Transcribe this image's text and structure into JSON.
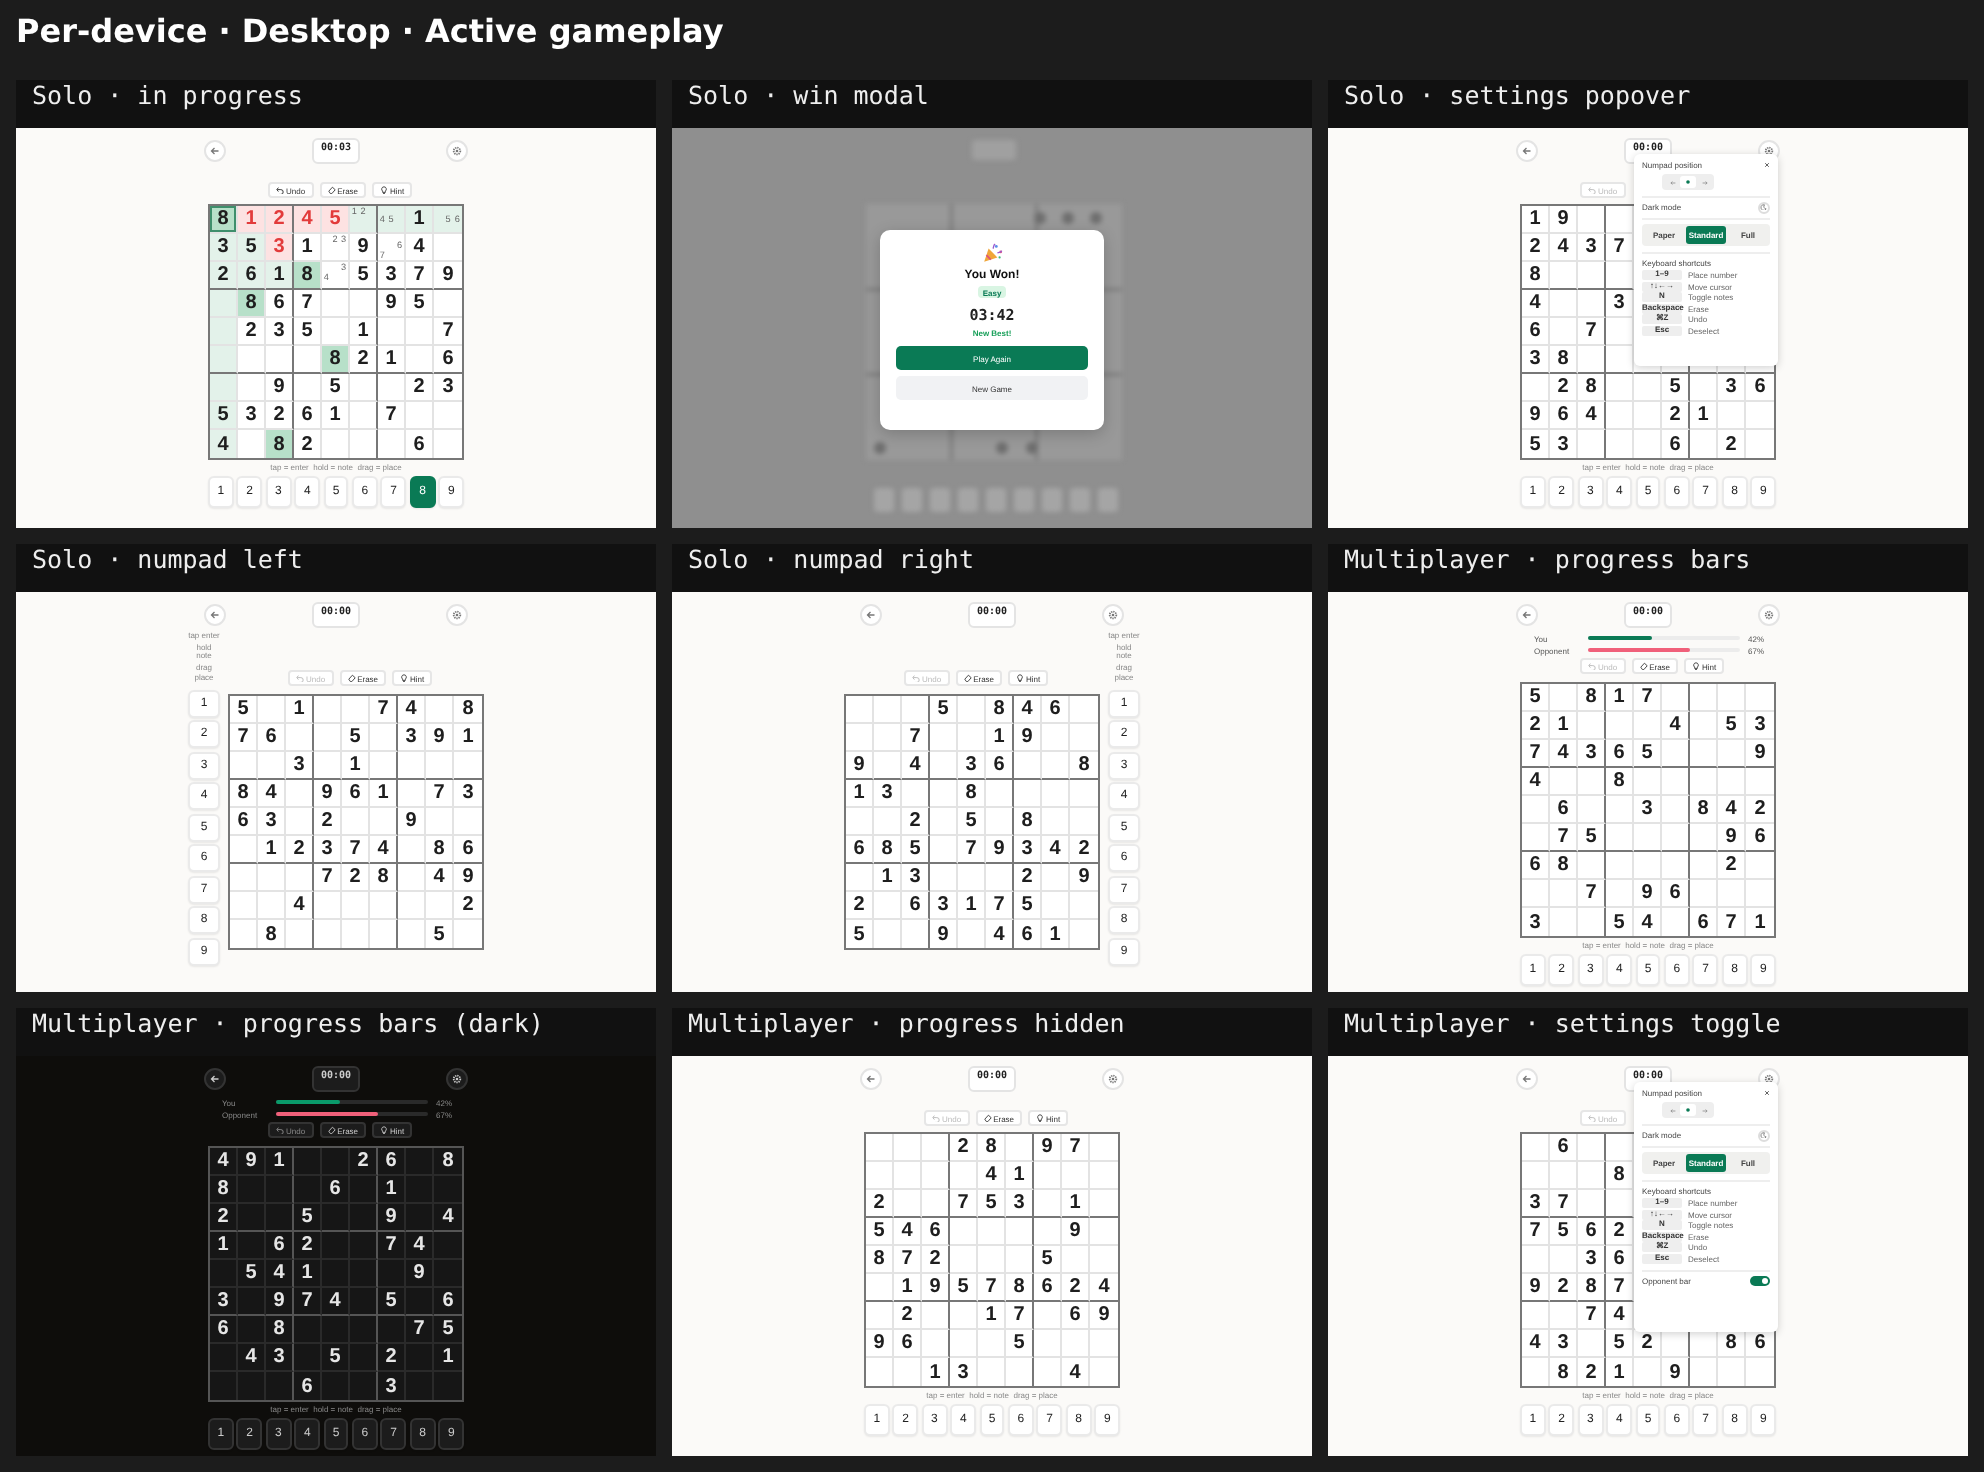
{
  "title": "Per-device · Desktop · Active gameplay",
  "panels": [
    {
      "label": "Solo · in progress",
      "kind": "bottom",
      "dark": false,
      "timer": "00:03",
      "toolbar": [
        {
          "kind": "undo",
          "label": "Undo",
          "disabled": false
        },
        {
          "kind": "erase",
          "label": "Erase",
          "disabled": false
        },
        {
          "kind": "hint",
          "label": "Hint",
          "disabled": false
        }
      ],
      "board": {
        "rows": [
          [
            {
              "value": "8",
              "selected": true
            },
            {
              "value": "1",
              "error": true
            },
            {
              "value": "2",
              "error": true
            },
            {
              "value": "4",
              "error": true
            },
            {
              "value": "5",
              "error": true
            },
            {
              "notes": [
                "1",
                "2"
              ]
            },
            {
              "notes": [
                "4",
                "5"
              ]
            },
            "1",
            {
              "notes": [
                "5",
                "6"
              ]
            }
          ],
          [
            "3",
            "5",
            {
              "value": "3",
              "error": true
            },
            "1",
            {
              "notes": [
                "2",
                "3"
              ]
            },
            "9",
            {
              "notes": [
                "6",
                "7"
              ]
            },
            "4",
            null
          ],
          [
            "2",
            "6",
            "1",
            "8",
            {
              "notes": [
                "3",
                "4"
              ]
            },
            "5",
            "3",
            "7",
            "9"
          ],
          [
            null,
            "8",
            "6",
            "7",
            null,
            null,
            "9",
            "5",
            null
          ],
          [
            null,
            "2",
            "3",
            "5",
            null,
            "1",
            null,
            null,
            "7"
          ],
          [
            null,
            null,
            null,
            null,
            "8",
            "2",
            "1",
            null,
            "6"
          ],
          [
            null,
            null,
            "9",
            null,
            "5",
            null,
            null,
            "2",
            "3"
          ],
          [
            "5",
            "3",
            "2",
            "6",
            "1",
            null,
            "7",
            null,
            null
          ],
          [
            "4",
            null,
            "8",
            "2",
            null,
            null,
            null,
            "6",
            null
          ]
        ]
      },
      "hint": "tap = enter  hold = note  drag = place",
      "numpad": [
        {
          "label": "1",
          "selected": false
        },
        {
          "label": "2",
          "selected": false
        },
        {
          "label": "3",
          "selected": false
        },
        {
          "label": "4",
          "selected": false
        },
        {
          "label": "5",
          "selected": false
        },
        {
          "label": "6",
          "selected": false
        },
        {
          "label": "7",
          "selected": false
        },
        {
          "label": "8",
          "selected": true
        },
        {
          "label": "9",
          "selected": false
        }
      ]
    },
    {
      "label": "Solo · win modal",
      "kind": "modal",
      "modal": {
        "title": "You Won!",
        "difficulty": "Easy",
        "time": "03:42",
        "note": "New Best!",
        "buttons": [
          {
            "kind": "primary",
            "label": "Play Again"
          },
          {
            "kind": "secondary",
            "label": "New Game"
          }
        ]
      }
    },
    {
      "label": "Solo · settings popover",
      "kind": "bottom",
      "dark": false,
      "timer": "00:00",
      "toolbar": [
        {
          "kind": "undo",
          "label": "Undo",
          "disabled": true
        }
      ],
      "board": {
        "rows": [
          [
            "1",
            "9",
            null,
            null,
            null,
            null,
            null,
            null,
            null
          ],
          [
            "2",
            "4",
            "3",
            "7",
            null,
            null,
            null,
            null,
            null
          ],
          [
            "8",
            null,
            null,
            null,
            null,
            null,
            null,
            null,
            null
          ],
          [
            "4",
            null,
            null,
            "3",
            null,
            null,
            null,
            null,
            null
          ],
          [
            "6",
            null,
            "7",
            null,
            null,
            null,
            null,
            null,
            null
          ],
          [
            "3",
            "8",
            null,
            null,
            null,
            null,
            null,
            null,
            null
          ],
          [
            null,
            "2",
            "8",
            null,
            null,
            "5",
            null,
            "3",
            "6"
          ],
          [
            "9",
            "6",
            "4",
            null,
            null,
            "2",
            "1",
            null,
            null
          ],
          [
            "5",
            "3",
            null,
            null,
            null,
            "6",
            null,
            "2",
            null
          ]
        ]
      },
      "hint": "tap = enter  hold = note  drag = place",
      "numpad": [
        {
          "label": "1",
          "selected": false
        },
        {
          "label": "2",
          "selected": false
        },
        {
          "label": "3",
          "selected": false
        },
        {
          "label": "4",
          "selected": false
        },
        {
          "label": "5",
          "selected": false
        },
        {
          "label": "6",
          "selected": false
        },
        {
          "label": "7",
          "selected": false
        },
        {
          "label": "8",
          "selected": false
        },
        {
          "label": "9",
          "selected": false
        }
      ],
      "popover": {
        "title": "Numpad position",
        "position_options": [
          {
            "kind": "left",
            "selected": false
          },
          {
            "kind": "center",
            "selected": true
          },
          {
            "kind": "right",
            "selected": false
          }
        ],
        "dark_mode_label": "Dark mode",
        "modes": [
          {
            "label": "Paper",
            "selected": false
          },
          {
            "label": "Standard",
            "selected": true
          },
          {
            "label": "Full",
            "selected": false
          }
        ],
        "shortcuts_title": "Keyboard shortcuts",
        "shortcuts": [
          {
            "key": "1–9",
            "action": "Place number"
          },
          {
            "key": "↑↓←→",
            "action": "Move cursor"
          },
          {
            "key": "N",
            "action": "Toggle notes"
          },
          {
            "key": "Backspace",
            "action": "Erase"
          },
          {
            "key": "⌘Z",
            "action": "Undo"
          },
          {
            "key": "Esc",
            "action": "Deselect"
          }
        ]
      }
    },
    {
      "label": "Solo · numpad left",
      "kind": "left",
      "dark": false,
      "timer": "00:00",
      "toolbar": [
        {
          "kind": "undo",
          "label": "Undo",
          "disabled": true
        },
        {
          "kind": "erase",
          "label": "Erase",
          "disabled": false
        },
        {
          "kind": "hint",
          "label": "Hint",
          "disabled": false
        }
      ],
      "board": {
        "rows": [
          [
            "5",
            null,
            "1",
            null,
            null,
            "7",
            "4",
            null,
            "8"
          ],
          [
            "7",
            "6",
            null,
            null,
            "5",
            null,
            "3",
            "9",
            "1"
          ],
          [
            null,
            null,
            "3",
            null,
            "1",
            null,
            null,
            null,
            null
          ],
          [
            "8",
            "4",
            null,
            "9",
            "6",
            "1",
            null,
            "7",
            "3"
          ],
          [
            "6",
            "3",
            null,
            "2",
            null,
            null,
            "9",
            null,
            null
          ],
          [
            null,
            "1",
            "2",
            "3",
            "7",
            "4",
            null,
            "8",
            "6"
          ],
          [
            null,
            null,
            null,
            "7",
            "2",
            "8",
            null,
            "4",
            "9"
          ],
          [
            null,
            null,
            "4",
            null,
            null,
            null,
            null,
            null,
            "2"
          ],
          [
            null,
            "8",
            null,
            null,
            null,
            null,
            null,
            "5",
            null
          ]
        ]
      },
      "hints": [
        "tap enter",
        "hold note",
        "drag place"
      ],
      "numpad": [
        {
          "label": "1",
          "selected": false
        },
        {
          "label": "2",
          "selected": false
        },
        {
          "label": "3",
          "selected": false
        },
        {
          "label": "4",
          "selected": false
        },
        {
          "label": "5",
          "selected": false
        },
        {
          "label": "6",
          "selected": false
        },
        {
          "label": "7",
          "selected": false
        },
        {
          "label": "8",
          "selected": false
        },
        {
          "label": "9",
          "selected": false
        }
      ]
    },
    {
      "label": "Solo · numpad right",
      "kind": "right",
      "dark": false,
      "timer": "00:00",
      "toolbar": [
        {
          "kind": "undo",
          "label": "Undo",
          "disabled": true
        },
        {
          "kind": "erase",
          "label": "Erase",
          "disabled": false
        },
        {
          "kind": "hint",
          "label": "Hint",
          "disabled": false
        }
      ],
      "board": {
        "rows": [
          [
            null,
            null,
            null,
            "5",
            null,
            "8",
            "4",
            "6",
            null
          ],
          [
            null,
            null,
            "7",
            null,
            null,
            "1",
            "9",
            null,
            null
          ],
          [
            "9",
            null,
            "4",
            null,
            "3",
            "6",
            null,
            null,
            "8"
          ],
          [
            "1",
            "3",
            null,
            null,
            "8",
            null,
            null,
            null,
            null
          ],
          [
            null,
            null,
            "2",
            null,
            "5",
            null,
            "8",
            null,
            null
          ],
          [
            "6",
            "8",
            "5",
            null,
            "7",
            "9",
            "3",
            "4",
            "2"
          ],
          [
            null,
            "1",
            "3",
            null,
            null,
            null,
            "2",
            null,
            "9"
          ],
          [
            "2",
            null,
            "6",
            "3",
            "1",
            "7",
            "5",
            null,
            null
          ],
          [
            "5",
            null,
            null,
            "9",
            null,
            "4",
            "6",
            "1",
            null
          ]
        ]
      },
      "hints": [
        "tap enter",
        "hold note",
        "drag place"
      ],
      "numpad": [
        {
          "label": "1",
          "selected": false
        },
        {
          "label": "2",
          "selected": false
        },
        {
          "label": "3",
          "selected": false
        },
        {
          "label": "4",
          "selected": false
        },
        {
          "label": "5",
          "selected": false
        },
        {
          "label": "6",
          "selected": false
        },
        {
          "label": "7",
          "selected": false
        },
        {
          "label": "8",
          "selected": false
        },
        {
          "label": "9",
          "selected": false
        }
      ]
    },
    {
      "label": "Multiplayer · progress bars",
      "kind": "bottom",
      "dark": false,
      "timer": "00:00",
      "progress": [
        {
          "name": "You",
          "level": 0.42,
          "reading": "42%",
          "color": "#0a7a55"
        },
        {
          "name": "Opponent",
          "level": 0.67,
          "reading": "67%",
          "color": "#f0607a"
        }
      ],
      "toolbar": [
        {
          "kind": "undo",
          "label": "Undo",
          "disabled": true
        },
        {
          "kind": "erase",
          "label": "Erase",
          "disabled": false
        },
        {
          "kind": "hint",
          "label": "Hint",
          "disabled": false
        }
      ],
      "board": {
        "rows": [
          [
            "5",
            null,
            "8",
            "1",
            "7",
            null,
            null,
            null,
            null
          ],
          [
            "2",
            "1",
            null,
            null,
            null,
            "4",
            null,
            "5",
            "3"
          ],
          [
            "7",
            "4",
            "3",
            "6",
            "5",
            null,
            null,
            null,
            "9"
          ],
          [
            "4",
            null,
            null,
            "8",
            null,
            null,
            null,
            null,
            null
          ],
          [
            null,
            "6",
            null,
            null,
            "3",
            null,
            "8",
            "4",
            "2"
          ],
          [
            null,
            "7",
            "5",
            null,
            null,
            null,
            null,
            "9",
            "6"
          ],
          [
            "6",
            "8",
            null,
            null,
            null,
            null,
            null,
            "2",
            null
          ],
          [
            null,
            null,
            "7",
            null,
            "9",
            "6",
            null,
            null,
            null
          ],
          [
            "3",
            null,
            null,
            "5",
            "4",
            null,
            "6",
            "7",
            "1"
          ]
        ]
      },
      "hint": "tap = enter  hold = note  drag = place",
      "numpad": [
        {
          "label": "1",
          "selected": false
        },
        {
          "label": "2",
          "selected": false
        },
        {
          "label": "3",
          "selected": false
        },
        {
          "label": "4",
          "selected": false
        },
        {
          "label": "5",
          "selected": false
        },
        {
          "label": "6",
          "selected": false
        },
        {
          "label": "7",
          "selected": false
        },
        {
          "label": "8",
          "selected": false
        },
        {
          "label": "9",
          "selected": false
        }
      ]
    },
    {
      "label": "Multiplayer · progress bars (dark)",
      "kind": "bottom",
      "dark": true,
      "timer": "00:00",
      "progress": [
        {
          "name": "You",
          "level": 0.42,
          "reading": "42%",
          "color": "#0a9a6a"
        },
        {
          "name": "Opponent",
          "level": 0.67,
          "reading": "67%",
          "color": "#f0607a"
        }
      ],
      "toolbar": [
        {
          "kind": "undo",
          "label": "Undo",
          "disabled": true
        },
        {
          "kind": "erase",
          "label": "Erase",
          "disabled": false
        },
        {
          "kind": "hint",
          "label": "Hint",
          "disabled": false
        }
      ],
      "board": {
        "rows": [
          [
            "4",
            "9",
            "1",
            null,
            null,
            "2",
            "6",
            null,
            "8"
          ],
          [
            "8",
            null,
            null,
            null,
            "6",
            null,
            "1",
            null,
            null
          ],
          [
            "2",
            null,
            null,
            "5",
            null,
            null,
            "9",
            null,
            "4"
          ],
          [
            "1",
            null,
            "6",
            "2",
            null,
            null,
            "7",
            "4",
            null
          ],
          [
            null,
            "5",
            "4",
            "1",
            null,
            null,
            null,
            "9",
            null
          ],
          [
            "3",
            null,
            "9",
            "7",
            "4",
            null,
            "5",
            null,
            "6"
          ],
          [
            "6",
            null,
            "8",
            null,
            null,
            null,
            null,
            "7",
            "5"
          ],
          [
            null,
            "4",
            "3",
            null,
            "5",
            null,
            "2",
            null,
            "1"
          ],
          [
            null,
            null,
            null,
            "6",
            null,
            null,
            "3",
            null,
            null
          ]
        ]
      },
      "hint": "tap = enter  hold = note  drag = place",
      "numpad": [
        {
          "label": "1",
          "selected": false
        },
        {
          "label": "2",
          "selected": false
        },
        {
          "label": "3",
          "selected": false
        },
        {
          "label": "4",
          "selected": false
        },
        {
          "label": "5",
          "selected": false
        },
        {
          "label": "6",
          "selected": false
        },
        {
          "label": "7",
          "selected": false
        },
        {
          "label": "8",
          "selected": false
        },
        {
          "label": "9",
          "selected": false
        }
      ]
    },
    {
      "label": "Multiplayer · progress hidden",
      "kind": "bottom",
      "dark": false,
      "timer": "00:00",
      "toolbar": [
        {
          "kind": "undo",
          "label": "Undo",
          "disabled": true
        },
        {
          "kind": "erase",
          "label": "Erase",
          "disabled": false
        },
        {
          "kind": "hint",
          "label": "Hint",
          "disabled": false
        }
      ],
      "board": {
        "rows": [
          [
            null,
            null,
            null,
            "2",
            "8",
            null,
            "9",
            "7",
            null
          ],
          [
            null,
            null,
            null,
            null,
            "4",
            "1",
            null,
            null,
            null
          ],
          [
            "2",
            null,
            null,
            "7",
            "5",
            "3",
            null,
            "1",
            null
          ],
          [
            "5",
            "4",
            "6",
            null,
            null,
            null,
            null,
            "9",
            null
          ],
          [
            "8",
            "7",
            "2",
            null,
            null,
            null,
            "5",
            null,
            null
          ],
          [
            null,
            "1",
            "9",
            "5",
            "7",
            "8",
            "6",
            "2",
            "4"
          ],
          [
            null,
            "2",
            null,
            null,
            "1",
            "7",
            null,
            "6",
            "9"
          ],
          [
            "9",
            "6",
            null,
            null,
            null,
            "5",
            null,
            null,
            null
          ],
          [
            null,
            null,
            "1",
            "3",
            null,
            null,
            null,
            "4",
            null
          ]
        ]
      },
      "hint": "tap = enter  hold = note  drag = place",
      "numpad": [
        {
          "label": "1",
          "selected": false
        },
        {
          "label": "2",
          "selected": false
        },
        {
          "label": "3",
          "selected": false
        },
        {
          "label": "4",
          "selected": false
        },
        {
          "label": "5",
          "selected": false
        },
        {
          "label": "6",
          "selected": false
        },
        {
          "label": "7",
          "selected": false
        },
        {
          "label": "8",
          "selected": false
        },
        {
          "label": "9",
          "selected": false
        }
      ]
    },
    {
      "label": "Multiplayer · settings toggle",
      "kind": "bottom",
      "dark": false,
      "timer": "00:00",
      "toolbar": [
        {
          "kind": "undo",
          "label": "Undo",
          "disabled": true
        }
      ],
      "board": {
        "rows": [
          [
            null,
            "6",
            null,
            null,
            null,
            null,
            null,
            null,
            null
          ],
          [
            null,
            null,
            null,
            "8",
            null,
            null,
            null,
            null,
            null
          ],
          [
            "3",
            "7",
            null,
            null,
            null,
            null,
            null,
            null,
            null
          ],
          [
            "7",
            "5",
            "6",
            "2",
            null,
            null,
            null,
            null,
            null
          ],
          [
            null,
            null,
            "3",
            "6",
            null,
            null,
            null,
            null,
            null
          ],
          [
            "9",
            "2",
            "8",
            "7",
            null,
            null,
            null,
            null,
            null
          ],
          [
            null,
            null,
            "7",
            "4",
            null,
            null,
            null,
            null,
            null
          ],
          [
            "4",
            "3",
            null,
            "5",
            "2",
            null,
            null,
            "8",
            "6"
          ],
          [
            null,
            "8",
            "2",
            "1",
            null,
            "9",
            null,
            null,
            null
          ]
        ]
      },
      "hint": "tap = enter  hold = note  drag = place",
      "numpad": [
        {
          "label": "1",
          "selected": false
        },
        {
          "label": "2",
          "selected": false
        },
        {
          "label": "3",
          "selected": false
        },
        {
          "label": "4",
          "selected": false
        },
        {
          "label": "5",
          "selected": false
        },
        {
          "label": "6",
          "selected": false
        },
        {
          "label": "7",
          "selected": false
        },
        {
          "label": "8",
          "selected": false
        },
        {
          "label": "9",
          "selected": false
        }
      ],
      "popover": {
        "title": "Numpad position",
        "position_options": [
          {
            "kind": "left",
            "selected": false
          },
          {
            "kind": "center",
            "selected": true
          },
          {
            "kind": "right",
            "selected": false
          }
        ],
        "dark_mode_label": "Dark mode",
        "modes": [
          {
            "label": "Paper",
            "selected": false
          },
          {
            "label": "Standard",
            "selected": true
          },
          {
            "label": "Full",
            "selected": false
          }
        ],
        "shortcuts_title": "Keyboard shortcuts",
        "shortcuts": [
          {
            "key": "1–9",
            "action": "Place number"
          },
          {
            "key": "↑↓←→",
            "action": "Move cursor"
          },
          {
            "key": "N",
            "action": "Toggle notes"
          },
          {
            "key": "Backspace",
            "action": "Erase"
          },
          {
            "key": "⌘Z",
            "action": "Undo"
          },
          {
            "key": "Esc",
            "action": "Deselect"
          }
        ],
        "toggles": [
          {
            "label": "Opponent bar",
            "on": true
          }
        ]
      }
    }
  ]
}
